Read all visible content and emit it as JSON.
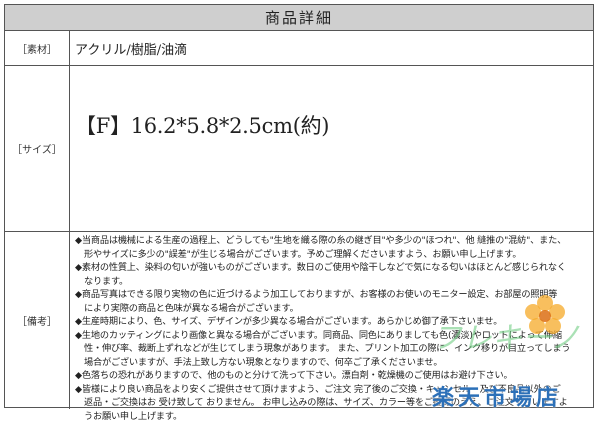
{
  "header": {
    "title": "商品詳細"
  },
  "rows": [
    {
      "label": "［素材］",
      "value": "アクリル/樹脂/油滴"
    },
    {
      "label": "［サイズ］",
      "value": "【F】16.2*5.8*2.5cm(約)"
    },
    {
      "label": "［備考］"
    }
  ],
  "notes": [
    "◆当商品は機械による生産の過程上、どうしても\"生地を織る際の糸の継ぎ目\"や多少の\"ほつれ\"、他 縫推の\"混紡\"、また、",
    "　形やサイズに多少の\"誤差\"が生じる場合がございます。予めご理解くださいますよう、お願い申し上げます。",
    "◆素材の性質上、染料の匂いが強いものがございます。数日のご使用や陰干しなどで気になる匂いはほとんど感じられなく",
    "　なります。",
    "◆商品写真はできる限り実物の色に近づけるよう加工しておりますが、お客様のお使いのモニター設定、お部屋の照明等",
    "　により実際の商品と色味が異なる場合がございます。",
    "◆生産時期により、色、サイズ、デザインが多少異なる場合がございます。あらかじめ御了承下さいませ。",
    "◆生地のカッティングにより画像と異なる場合がございます。同商品、同色にありましても色(濃淡)やロットによって伸縮",
    "　性・伸び率、裁断上ずれなどが生じてしまう現象があります。 また、プリント加工の際に、インク移りが目立ってしまう",
    "　場合がございますが、手法上致し方ない現象となりますので、何卒ご了承くださいませ。",
    "◆色落ちの恐れがありますので、他のものと分けて洗って下さい。漂白剤・乾燥機のご使用はお避け下さい。",
    "◆皆様により良い商品をより安くご提供させて頂けますよう、ご注文 完了後のご交換・キャンセル・及び不良品以外のご",
    "　返品・ご交換はお 受け致して おりません。 お申し込みの際は、サイズ、カラー等をご確認のうえ、ご注文下さいますよ",
    "　うお願い申し上げます。"
  ],
  "watermark": {
    "text": "フレキーノ",
    "brand": "楽天市場店"
  }
}
